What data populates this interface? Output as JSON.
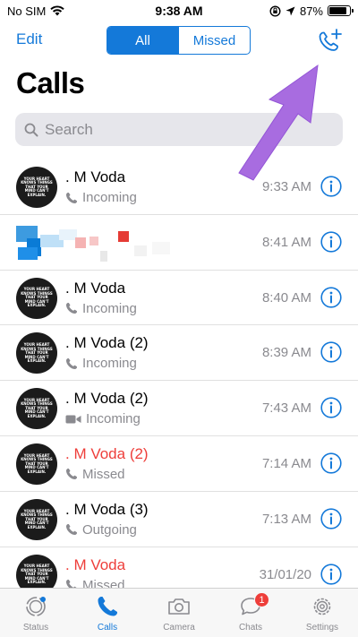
{
  "status_bar": {
    "carrier": "No SIM",
    "time": "9:38 AM",
    "battery": "87%",
    "battery_level": 0.87
  },
  "header": {
    "edit_label": "Edit",
    "seg_all": "All",
    "seg_missed": "Missed",
    "title": "Calls"
  },
  "search": {
    "placeholder": "Search"
  },
  "calls": [
    {
      "name": ". M Voda",
      "type": "Incoming",
      "time": "9:33 AM",
      "missed": false,
      "video": false
    },
    {
      "name": "",
      "type": "",
      "time": "8:41 AM",
      "missed": false,
      "video": false
    },
    {
      "name": ". M Voda",
      "type": "Incoming",
      "time": "8:40 AM",
      "missed": false,
      "video": false
    },
    {
      "name": ". M Voda  (2)",
      "type": "Incoming",
      "time": "8:39 AM",
      "missed": false,
      "video": false
    },
    {
      "name": ". M Voda  (2)",
      "type": "Incoming",
      "time": "7:43 AM",
      "missed": false,
      "video": true
    },
    {
      "name": ". M Voda  (2)",
      "type": "Missed",
      "time": "7:14 AM",
      "missed": true,
      "video": false
    },
    {
      "name": ". M Voda  (3)",
      "type": "Outgoing",
      "time": "7:13 AM",
      "missed": false,
      "video": false
    },
    {
      "name": ". M Voda",
      "type": "Missed",
      "time": "31/01/20",
      "missed": true,
      "video": false
    }
  ],
  "avatar_text": [
    "YOUR HEART",
    "KNOWS THINGS",
    "THAT YOUR",
    "MIND CAN'T",
    "EXPLAIN."
  ],
  "tabs": [
    {
      "label": "Status",
      "active": false
    },
    {
      "label": "Calls",
      "active": true
    },
    {
      "label": "Camera",
      "active": false
    },
    {
      "label": "Chats",
      "active": false,
      "badge": "1"
    },
    {
      "label": "Settings",
      "active": false
    }
  ],
  "colors": {
    "accent": "#1479d9",
    "missed": "#ee3e3a",
    "annotation": "#a86ce0"
  }
}
